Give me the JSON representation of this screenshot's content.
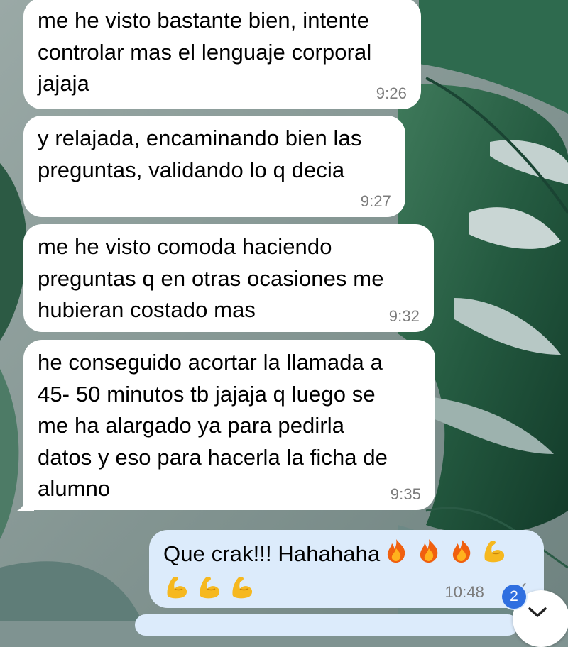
{
  "messages": [
    {
      "direction": "incoming",
      "text": "me he visto bastante bien, intente\ncontrolar mas el lenguaje corporal\njajaja",
      "time": "9:26"
    },
    {
      "direction": "incoming",
      "text": "y relajada, encaminando bien las\npreguntas, validando lo q decia",
      "time": "9:27"
    },
    {
      "direction": "incoming",
      "text": "me he visto comoda haciendo\npreguntas q en otras ocasiones me\nhubieran costado mas",
      "time": "9:32"
    },
    {
      "direction": "incoming",
      "text": "he conseguido acortar la llamada a\n45- 50 minutos tb jajaja q luego se\nme ha alargado ya para pedirla\ndatos y eso para hacerla la ficha de\nalumno",
      "time": "9:35"
    },
    {
      "direction": "outgoing",
      "text": "Que crak!!! Hahahaha",
      "emojis_line1": [
        "fire-emoji",
        "fire-emoji",
        "fire-emoji",
        "flexed-biceps-emoji"
      ],
      "emojis_line2": [
        "flexed-biceps-emoji",
        "flexed-biceps-emoji",
        "flexed-biceps-emoji"
      ],
      "time": "10:48"
    }
  ],
  "unread_badge": "2",
  "colors": {
    "incoming_bubble": "#ffffff",
    "outgoing_bubble": "#dcebfb",
    "time_text": "#7c7c7c",
    "badge": "#2f6fe0"
  }
}
